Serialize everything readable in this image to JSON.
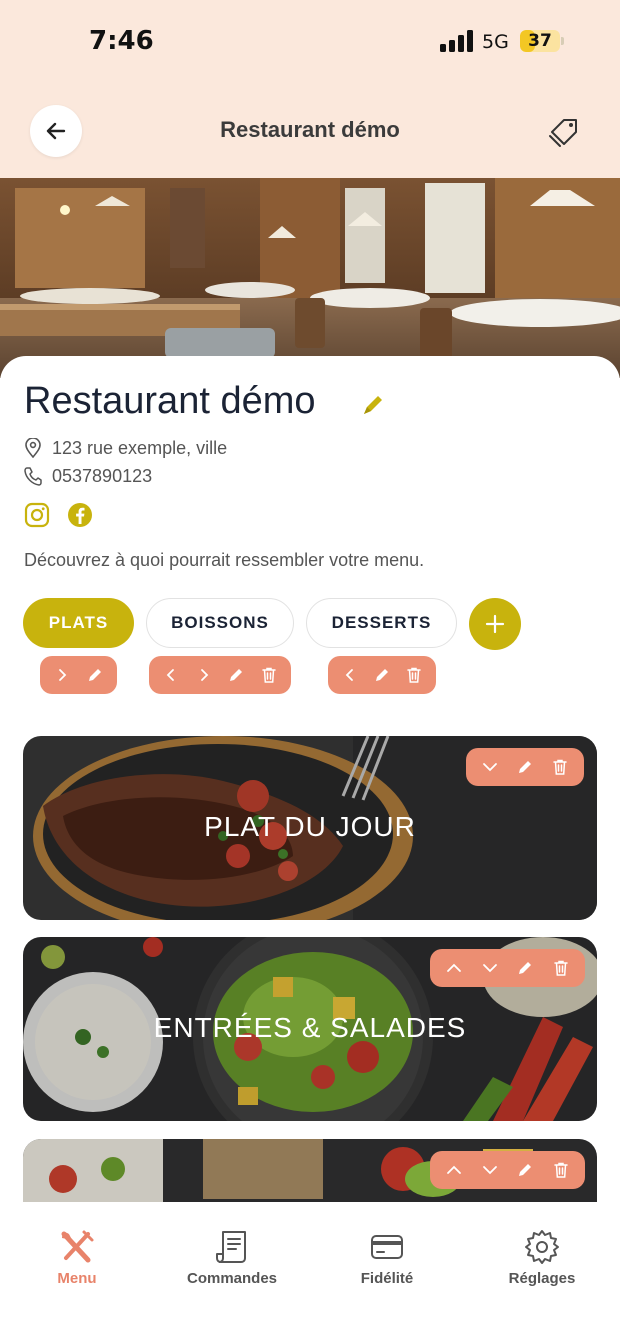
{
  "status_bar": {
    "time": "7:46",
    "network": "5G",
    "battery_level": "37",
    "battery_fraction": 0.37
  },
  "header": {
    "title": "Restaurant démo",
    "back_icon": "arrow-left-icon",
    "tag_icon": "tag-icon"
  },
  "restaurant": {
    "name": "Restaurant démo",
    "address": "123 rue exemple, ville",
    "phone": "0537890123",
    "description": "Découvrez à quoi pourrait ressembler votre menu."
  },
  "categories": [
    {
      "label": "PLATS",
      "active": true
    },
    {
      "label": "BOISSONS",
      "active": false
    },
    {
      "label": "DESSERTS",
      "active": false
    }
  ],
  "sections": [
    {
      "title": "PLAT DU JOUR"
    },
    {
      "title": "ENTRÉES & SALADES"
    },
    {
      "title": ""
    }
  ],
  "bottom_nav": {
    "items": [
      {
        "label": "Menu",
        "icon": "fork-knife-icon",
        "active": true
      },
      {
        "label": "Commandes",
        "icon": "receipt-icon",
        "active": false
      },
      {
        "label": "Fidélité",
        "icon": "card-icon",
        "active": false
      },
      {
        "label": "Réglages",
        "icon": "gear-icon",
        "active": false
      }
    ]
  },
  "colors": {
    "accent_yellow": "#c8b30d",
    "accent_salmon": "#ec8e72",
    "nav_active": "#e8836a",
    "header_bg": "#fbe8dc"
  }
}
